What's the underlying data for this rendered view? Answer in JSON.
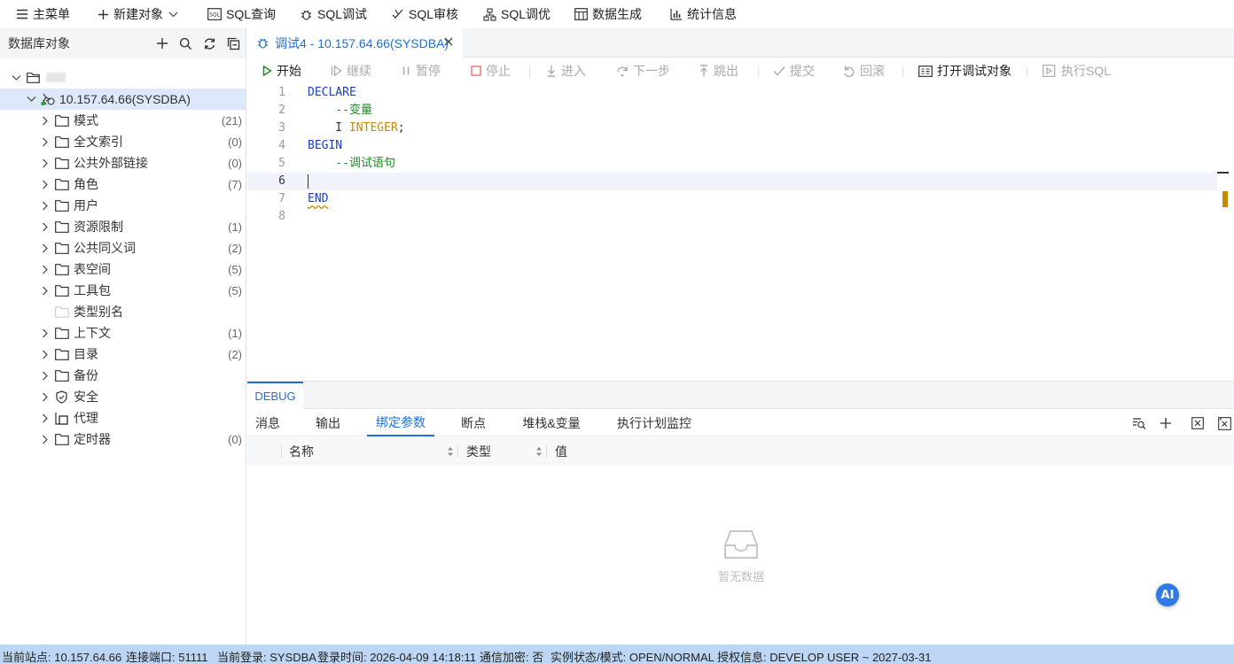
{
  "topmenu": {
    "main_menu": "主菜单",
    "new_object": "新建对象",
    "sql_query": "SQL查询",
    "sql_debug": "SQL调试",
    "sql_audit": "SQL审核",
    "sql_tune": "SQL调优",
    "data_gen": "数据生成",
    "stats": "统计信息"
  },
  "left_panel": {
    "title": "数据库对象",
    "connection": "10.157.64.66(SYSDBA)",
    "items": [
      {
        "label": "模式",
        "count": "(21)"
      },
      {
        "label": "全文索引",
        "count": "(0)"
      },
      {
        "label": "公共外部链接",
        "count": "(0)"
      },
      {
        "label": "角色",
        "count": "(7)"
      },
      {
        "label": "用户",
        "count": ""
      },
      {
        "label": "资源限制",
        "count": "(1)"
      },
      {
        "label": "公共同义词",
        "count": "(2)"
      },
      {
        "label": "表空间",
        "count": "(5)"
      },
      {
        "label": "工具包",
        "count": "(5)"
      },
      {
        "label": "类型别名",
        "count": ""
      },
      {
        "label": "上下文",
        "count": "(1)"
      },
      {
        "label": "目录",
        "count": "(2)"
      },
      {
        "label": "备份",
        "count": ""
      },
      {
        "label": "安全",
        "count": ""
      },
      {
        "label": "代理",
        "count": ""
      },
      {
        "label": "定时器",
        "count": "(0)"
      }
    ]
  },
  "tab": {
    "label": "调试4 - 10.157.64.66(SYSDBA)"
  },
  "debug_toolbar": {
    "start": "开始",
    "continue": "继续",
    "pause": "暂停",
    "stop": "停止",
    "step_in": "进入",
    "next_step": "下一步",
    "step_out": "跳出",
    "commit": "提交",
    "rollback": "回滚",
    "open_debug_object": "打开调试对象",
    "execute_sql": "执行SQL"
  },
  "editor": {
    "line_numbers": [
      "1",
      "2",
      "3",
      "4",
      "5",
      "6",
      "7",
      "8"
    ],
    "l1": "DECLARE",
    "l2": "    --变量",
    "l3_a": "    I ",
    "l3_b": "INTEGER",
    "l3_c": ";",
    "l4": "BEGIN",
    "l5": "    --调试语句",
    "l7": "END"
  },
  "debug_panel": {
    "title": "DEBUG",
    "tabs": [
      "消息",
      "输出",
      "绑定参数",
      "断点",
      "堆栈&变量",
      "执行计划监控"
    ],
    "active_tab": "绑定参数",
    "columns": [
      "名称",
      "类型",
      "值"
    ],
    "empty_text": "暂无数据",
    "ai_label": "AI"
  },
  "status_bar": {
    "site": "当前站点: 10.157.64.66",
    "port": "连接端口: 51111",
    "login": "当前登录: SYSDBA",
    "login_time": "登录时间: 2026-04-09 14:18:11",
    "encryption": "通信加密: 否",
    "instance": "实例状态/模式: OPEN/NORMAL",
    "license": "授权信息: DEVELOP USER ~ 2027-03-31"
  },
  "colors": {
    "accent": "#1f6fd8",
    "status_bg": "#bcd6f4",
    "keyword": "#1a3fc0",
    "comment": "#1f8a22",
    "type": "#c48a00"
  }
}
